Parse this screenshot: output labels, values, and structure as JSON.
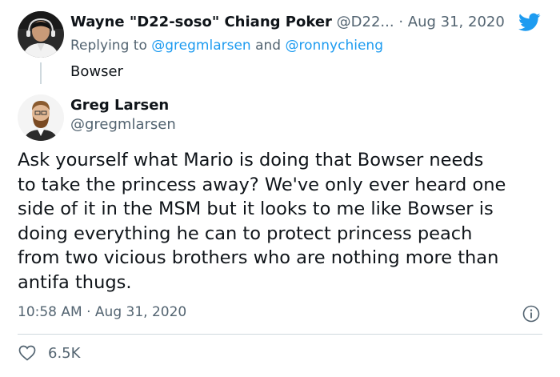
{
  "parent_tweet": {
    "author_name": "Wayne \"D22-soso\" Chiang Poker",
    "author_handle": "@D22...",
    "date": "· Aug 31, 2020",
    "replying_prefix": "Replying to",
    "replying_to_1": "@gregmlarsen",
    "replying_and": "and",
    "replying_to_2": "@ronnychieng",
    "text": "Bowser"
  },
  "main_tweet": {
    "author_name": "Greg Larsen",
    "author_handle": "@gregmlarsen",
    "text_lines": [
      "Ask yourself what Mario is doing that Bowser needs",
      "to take the princess away? We've only ever heard one",
      "side of it in the MSM but it looks to me like Bowser is",
      "doing everything he can to protect princess peach",
      "from two vicious brothers who are nothing more than",
      "antifa thugs."
    ],
    "time": "10:58 AM",
    "date": "Aug 31, 2020",
    "like_count": "6.5K"
  },
  "icons": {
    "brand": "twitter-bird-icon",
    "info": "info-icon",
    "like": "heart-icon"
  },
  "colors": {
    "accent": "#1d9bf0",
    "text": "#0f1419",
    "secondary": "#536471",
    "divider": "#cfd9de"
  }
}
